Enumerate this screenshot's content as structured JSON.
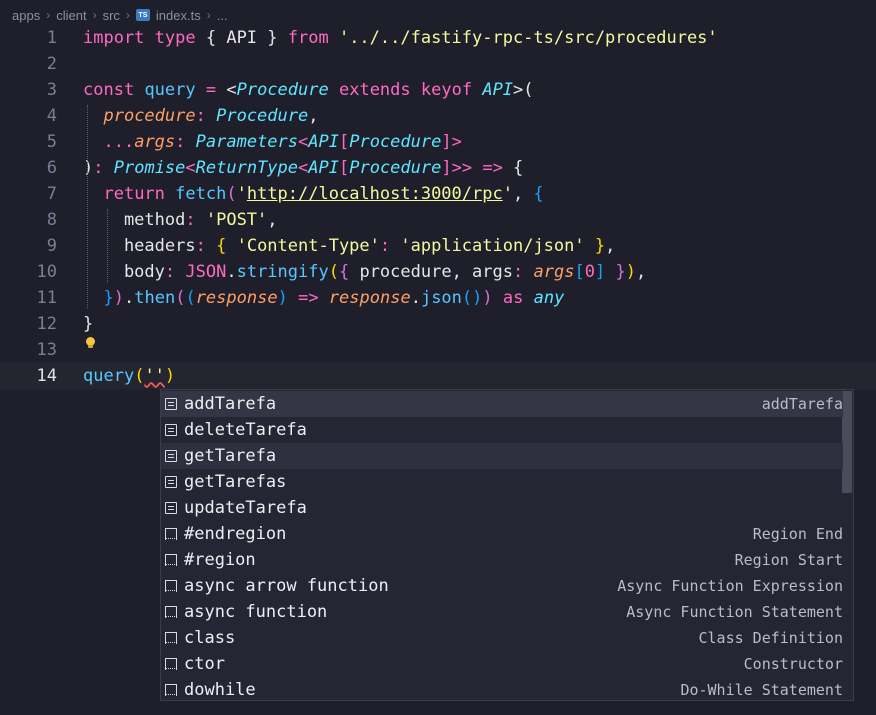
{
  "breadcrumb": {
    "items": [
      "apps",
      "client",
      "src",
      "index.ts",
      "..."
    ],
    "file_icon": "TS"
  },
  "editor": {
    "line_numbers": [
      "1",
      "2",
      "3",
      "4",
      "5",
      "6",
      "7",
      "8",
      "9",
      "10",
      "11",
      "12",
      "13",
      "14"
    ],
    "active_line": "14",
    "lines": {
      "l1": [
        {
          "c": "k",
          "t": "import"
        },
        {
          "c": "w",
          "t": " "
        },
        {
          "c": "k",
          "t": "type"
        },
        {
          "c": "w",
          "t": " { API } "
        },
        {
          "c": "k",
          "t": "from"
        },
        {
          "c": "w",
          "t": " "
        },
        {
          "c": "s",
          "t": "'../../fastify-rpc-ts/src/procedures'"
        }
      ],
      "l3": [
        {
          "c": "k",
          "t": "const"
        },
        {
          "c": "w",
          "t": " "
        },
        {
          "c": "f",
          "t": "query"
        },
        {
          "c": "w",
          "t": " "
        },
        {
          "c": "o",
          "t": "="
        },
        {
          "c": "w",
          "t": " <"
        },
        {
          "c": "t",
          "t": "Procedure"
        },
        {
          "c": "w",
          "t": " "
        },
        {
          "c": "k",
          "t": "extends"
        },
        {
          "c": "w",
          "t": " "
        },
        {
          "c": "k",
          "t": "keyof"
        },
        {
          "c": "w",
          "t": " "
        },
        {
          "c": "t",
          "t": "API"
        },
        {
          "c": "w",
          "t": ">("
        }
      ],
      "l4": [
        {
          "c": "w",
          "t": "  "
        },
        {
          "c": "p",
          "t": "procedure"
        },
        {
          "c": "o",
          "t": ":"
        },
        {
          "c": "w",
          "t": " "
        },
        {
          "c": "t",
          "t": "Procedure"
        },
        {
          "c": "w",
          "t": ","
        }
      ],
      "l5": [
        {
          "c": "w",
          "t": "  "
        },
        {
          "c": "o",
          "t": "..."
        },
        {
          "c": "p",
          "t": "args"
        },
        {
          "c": "o",
          "t": ":"
        },
        {
          "c": "w",
          "t": " "
        },
        {
          "c": "t",
          "t": "Parameters"
        },
        {
          "c": "o",
          "t": "<"
        },
        {
          "c": "t",
          "t": "API"
        },
        {
          "c": "o",
          "t": "["
        },
        {
          "c": "t",
          "t": "Procedure"
        },
        {
          "c": "o",
          "t": "]>"
        }
      ],
      "l6": [
        {
          "c": "w",
          "t": ")"
        },
        {
          "c": "o",
          "t": ":"
        },
        {
          "c": "w",
          "t": " "
        },
        {
          "c": "t",
          "t": "Promise"
        },
        {
          "c": "o",
          "t": "<"
        },
        {
          "c": "t",
          "t": "ReturnType"
        },
        {
          "c": "o",
          "t": "<"
        },
        {
          "c": "t",
          "t": "API"
        },
        {
          "c": "o",
          "t": "["
        },
        {
          "c": "t",
          "t": "Procedure"
        },
        {
          "c": "o",
          "t": "]>>"
        },
        {
          "c": "w",
          "t": " "
        },
        {
          "c": "o",
          "t": "=>"
        },
        {
          "c": "w",
          "t": " {"
        }
      ],
      "l7": [
        {
          "c": "w",
          "t": "  "
        },
        {
          "c": "k",
          "t": "return"
        },
        {
          "c": "w",
          "t": " "
        },
        {
          "c": "f",
          "t": "fetch"
        },
        {
          "c": "b2",
          "t": "("
        },
        {
          "c": "s",
          "t": "'"
        },
        {
          "c": "su",
          "t": "http://localhost:3000/rpc"
        },
        {
          "c": "s",
          "t": "'"
        },
        {
          "c": "w",
          "t": ", "
        },
        {
          "c": "b3",
          "t": "{"
        }
      ],
      "l8": [
        {
          "c": "w",
          "t": "    method"
        },
        {
          "c": "o",
          "t": ":"
        },
        {
          "c": "w",
          "t": " "
        },
        {
          "c": "s",
          "t": "'POST'"
        },
        {
          "c": "w",
          "t": ","
        }
      ],
      "l9": [
        {
          "c": "w",
          "t": "    headers"
        },
        {
          "c": "o",
          "t": ":"
        },
        {
          "c": "w",
          "t": " "
        },
        {
          "c": "b1",
          "t": "{"
        },
        {
          "c": "w",
          "t": " "
        },
        {
          "c": "s",
          "t": "'Content-Type'"
        },
        {
          "c": "o",
          "t": ":"
        },
        {
          "c": "w",
          "t": " "
        },
        {
          "c": "s",
          "t": "'application/json'"
        },
        {
          "c": "w",
          "t": " "
        },
        {
          "c": "b1",
          "t": "}"
        },
        {
          "c": "w",
          "t": ","
        }
      ],
      "l10": [
        {
          "c": "w",
          "t": "    body"
        },
        {
          "c": "o",
          "t": ":"
        },
        {
          "c": "w",
          "t": " "
        },
        {
          "c": "k",
          "t": "JSON"
        },
        {
          "c": "w",
          "t": "."
        },
        {
          "c": "f",
          "t": "stringify"
        },
        {
          "c": "b1",
          "t": "("
        },
        {
          "c": "b2",
          "t": "{"
        },
        {
          "c": "w",
          "t": " procedure, args"
        },
        {
          "c": "o",
          "t": ":"
        },
        {
          "c": "w",
          "t": " "
        },
        {
          "c": "p",
          "t": "args"
        },
        {
          "c": "b3",
          "t": "["
        },
        {
          "c": "k",
          "t": "0"
        },
        {
          "c": "b3",
          "t": "]"
        },
        {
          "c": "w",
          "t": " "
        },
        {
          "c": "b2",
          "t": "}"
        },
        {
          "c": "b1",
          "t": ")"
        },
        {
          "c": "w",
          "t": ","
        }
      ],
      "l11": [
        {
          "c": "w",
          "t": "  "
        },
        {
          "c": "b3",
          "t": "}"
        },
        {
          "c": "b2",
          "t": ")"
        },
        {
          "c": "w",
          "t": "."
        },
        {
          "c": "f",
          "t": "then"
        },
        {
          "c": "b2",
          "t": "("
        },
        {
          "c": "b3",
          "t": "("
        },
        {
          "c": "p",
          "t": "response"
        },
        {
          "c": "b3",
          "t": ")"
        },
        {
          "c": "w",
          "t": " "
        },
        {
          "c": "o",
          "t": "=>"
        },
        {
          "c": "w",
          "t": " "
        },
        {
          "c": "p",
          "t": "response"
        },
        {
          "c": "w",
          "t": "."
        },
        {
          "c": "f",
          "t": "json"
        },
        {
          "c": "b3",
          "t": "()"
        },
        {
          "c": "b2",
          "t": ")"
        },
        {
          "c": "w",
          "t": " "
        },
        {
          "c": "k",
          "t": "as"
        },
        {
          "c": "w",
          "t": " "
        },
        {
          "c": "t",
          "t": "any"
        }
      ],
      "l12": [
        {
          "c": "w",
          "t": "}"
        }
      ],
      "l14": [
        {
          "c": "f",
          "t": "query"
        },
        {
          "c": "b1",
          "t": "("
        },
        {
          "c": "sq",
          "t": "''"
        },
        {
          "c": "b1",
          "t": ")"
        }
      ]
    }
  },
  "suggest": {
    "items": [
      {
        "icon": "list-icon",
        "label": "addTarefa",
        "detail": "addTarefa"
      },
      {
        "icon": "list-icon",
        "label": "deleteTarefa",
        "detail": ""
      },
      {
        "icon": "list-icon",
        "label": "getTarefa",
        "detail": ""
      },
      {
        "icon": "list-icon",
        "label": "getTarefas",
        "detail": ""
      },
      {
        "icon": "list-icon",
        "label": "updateTarefa",
        "detail": ""
      },
      {
        "icon": "snippet-icon",
        "label": "#endregion",
        "detail": "Region End"
      },
      {
        "icon": "snippet-icon",
        "label": "#region",
        "detail": "Region Start"
      },
      {
        "icon": "snippet-icon",
        "label": "async arrow function",
        "detail": "Async Function Expression"
      },
      {
        "icon": "snippet-icon",
        "label": "async function",
        "detail": "Async Function Statement"
      },
      {
        "icon": "snippet-icon",
        "label": "class",
        "detail": "Class Definition"
      },
      {
        "icon": "snippet-icon",
        "label": "ctor",
        "detail": "Constructor"
      },
      {
        "icon": "snippet-icon",
        "label": "dowhile",
        "detail": "Do-While Statement"
      }
    ],
    "selected_index": 0,
    "hover_index": 2
  }
}
